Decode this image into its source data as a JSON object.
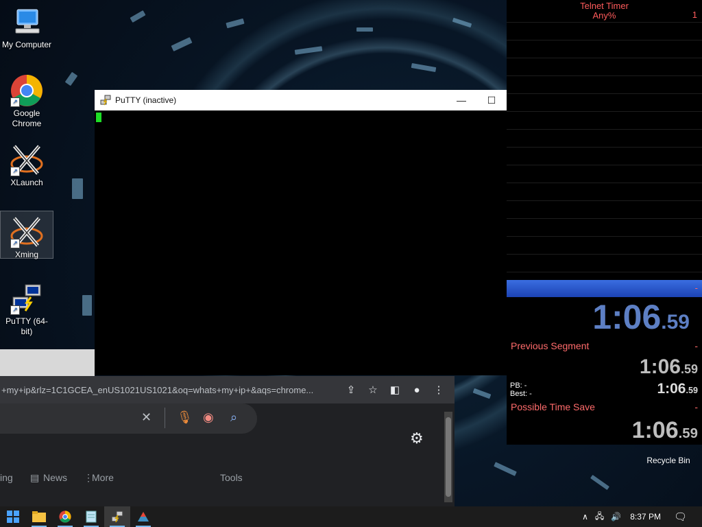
{
  "desktop_icons": [
    {
      "label": "My Computer"
    },
    {
      "label": "Google Chrome"
    },
    {
      "label": "XLaunch"
    },
    {
      "label": "Xming"
    },
    {
      "label": "PuTTY (64-bit)"
    }
  ],
  "recycle_bin": {
    "label": "Recycle Bin"
  },
  "putty": {
    "title": "PuTTY (inactive)",
    "minimize": "—",
    "maximize": "☐"
  },
  "timer": {
    "title": "Telnet Timer",
    "category": "Any%",
    "attempts": "1",
    "current_split_delta": "-",
    "main_time": "1:06",
    "main_time_fraction": ".59",
    "previous_segment_label": "Previous Segment",
    "previous_segment_value": "-",
    "segment_time": "1:06",
    "segment_time_fraction": ".59",
    "pb_label": "PB:",
    "pb_value": "-",
    "best_label": "Best:",
    "best_value": "-",
    "best_time": "1:06",
    "best_time_fraction": ".59",
    "possible_time_save_label": "Possible Time Save",
    "possible_time_save_value": "-",
    "sum_time": "1:06",
    "sum_time_fraction": ".59"
  },
  "chrome": {
    "url": "+my+ip&rlz=1C1GCEA_enUS1021US1021&oq=whats+my+ip+&aqs=chrome...",
    "tabs": [
      {
        "label": "ing"
      },
      {
        "label": "News"
      },
      {
        "label": "More"
      },
      {
        "label": "Tools"
      }
    ]
  },
  "taskbar": {
    "time": "8:37 PM"
  },
  "colors": {
    "timer_red": "#ff6b6b",
    "timer_blue": "#5d7fc4",
    "cursor_green": "#1dde26"
  }
}
